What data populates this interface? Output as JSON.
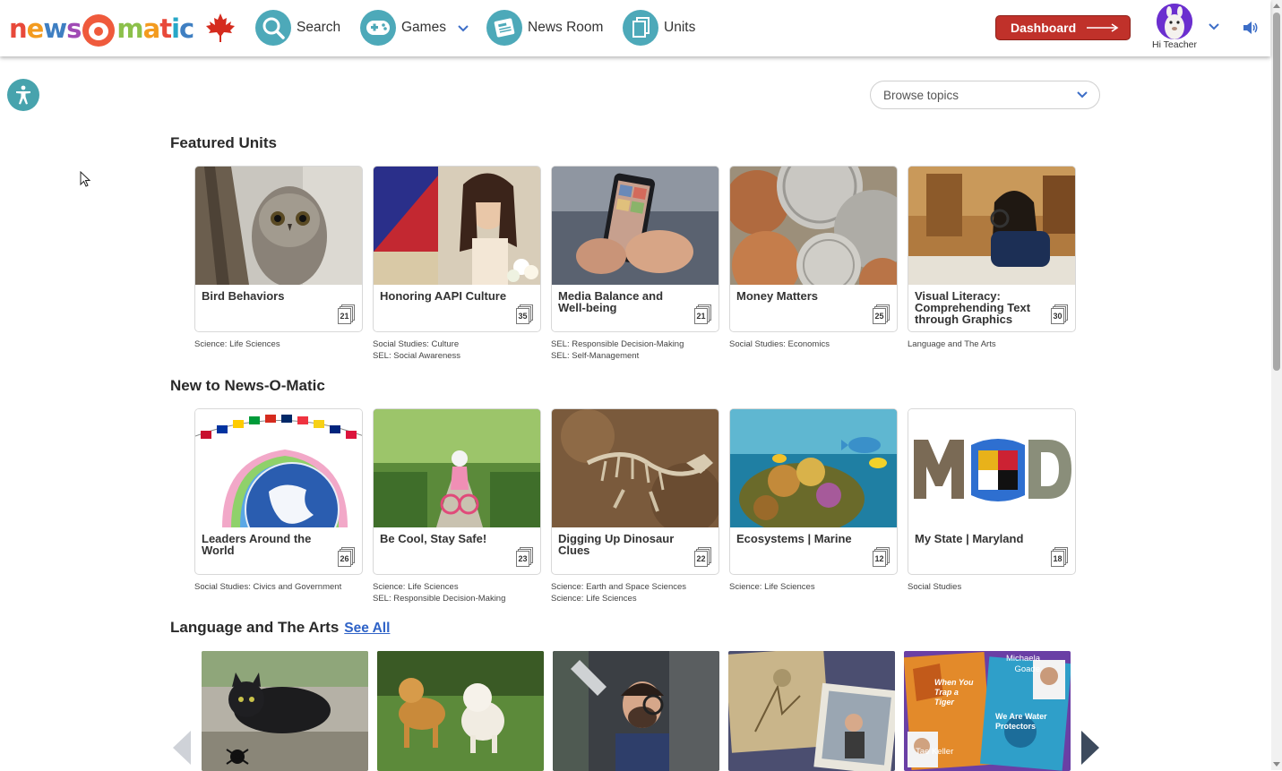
{
  "header": {
    "logo": {
      "parts": [
        "n",
        "e",
        "w",
        "s",
        "-",
        "m",
        "a",
        "t",
        "i",
        "c"
      ]
    },
    "nav": [
      {
        "label": "Search",
        "icon": "search-icon"
      },
      {
        "label": "Games",
        "icon": "gamepad-icon"
      },
      {
        "label": "News Room",
        "icon": "newspaper-icon"
      },
      {
        "label": "Units",
        "icon": "units-icon"
      }
    ],
    "dashboard_label": "Dashboard",
    "user_greeting": "Hi Teacher",
    "accent": "#c0312a"
  },
  "browse": {
    "label": "Browse topics"
  },
  "sections": [
    {
      "title": "Featured Units",
      "cards": [
        {
          "title": "Bird Behaviors",
          "count": "21",
          "subjects": [
            "Science: Life Sciences"
          ]
        },
        {
          "title": "Honoring AAPI Culture",
          "count": "35",
          "subjects": [
            "Social Studies: Culture",
            "SEL: Social Awareness"
          ]
        },
        {
          "title": "Media Balance and Well-being",
          "count": "21",
          "subjects": [
            "SEL: Responsible Decision-Making",
            "SEL: Self-Management"
          ]
        },
        {
          "title": "Money Matters",
          "count": "25",
          "subjects": [
            "Social Studies: Economics"
          ]
        },
        {
          "title": "Visual Literacy: Comprehending Text through Graphics",
          "count": "30",
          "subjects": [
            "Language and The Arts"
          ]
        }
      ]
    },
    {
      "title": "New to News-O-Matic",
      "cards": [
        {
          "title": "Leaders Around the World",
          "count": "26",
          "subjects": [
            "Social Studies: Civics and Government"
          ]
        },
        {
          "title": "Be Cool, Stay Safe!",
          "count": "23",
          "subjects": [
            "Science: Life Sciences",
            "SEL: Responsible Decision-Making"
          ]
        },
        {
          "title": "Digging Up Dinosaur Clues",
          "count": "22",
          "subjects": [
            "Science: Earth and Space Sciences",
            "Science: Life Sciences"
          ]
        },
        {
          "title": "Ecosystems | Marine",
          "count": "12",
          "subjects": [
            "Science: Life Sciences"
          ]
        },
        {
          "title": "My State | Maryland",
          "count": "18",
          "subjects": [
            "Social Studies"
          ]
        }
      ]
    },
    {
      "title": "Language and The Arts",
      "see_all": "See All",
      "book": {
        "author1": "Michaela Goade",
        "author2": "Tae Keller",
        "book1": "When You Trap a Tiger",
        "book2": "We Are Water Protectors"
      }
    }
  ]
}
